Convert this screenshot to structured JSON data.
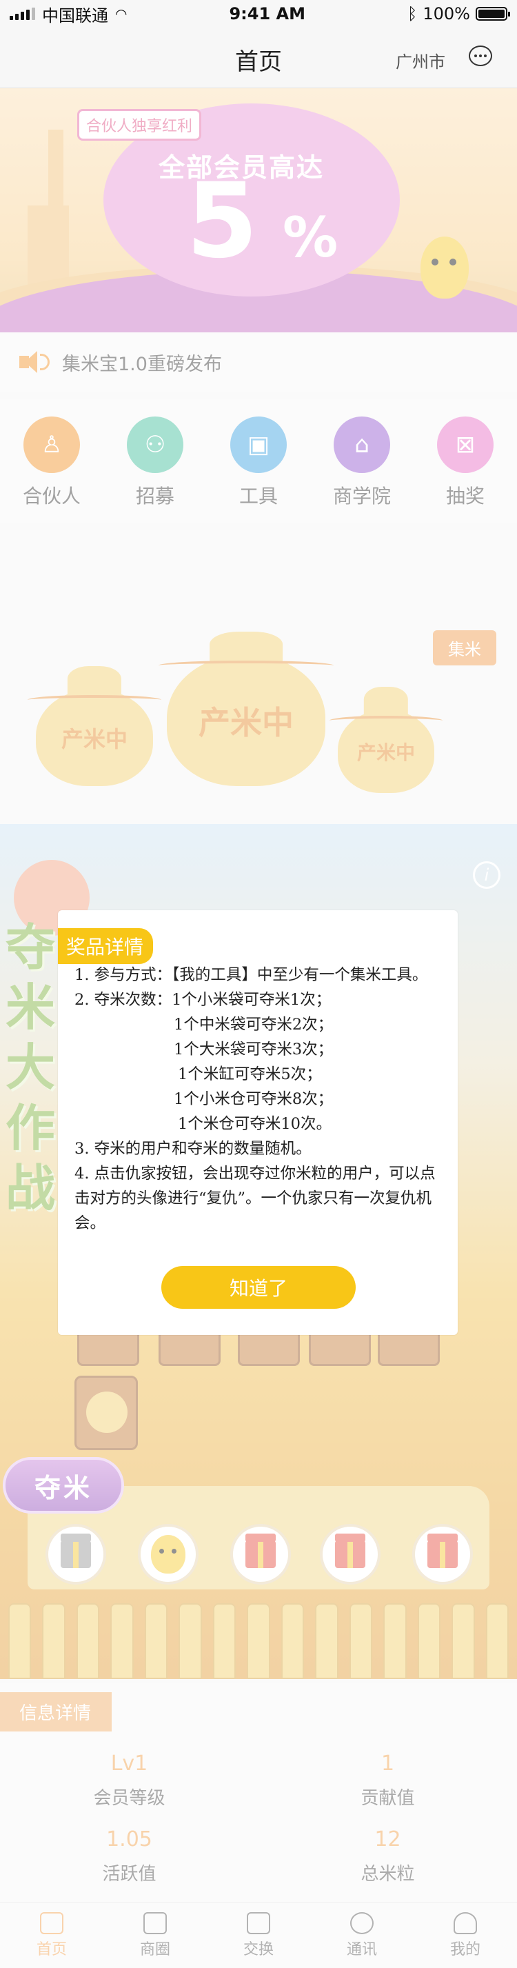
{
  "status_bar": {
    "carrier": "中国联通",
    "time": "9:41 AM",
    "battery": "100%"
  },
  "nav": {
    "title": "首页",
    "city": "广州市",
    "chat_icon": "chat-bubble-icon"
  },
  "banner": {
    "tag": "合伙人独享红利",
    "headline": "全部会员高达",
    "number": "5",
    "percent": "%"
  },
  "notice": {
    "text": "集米宝1.0重磅发布",
    "icon": "speaker-icon"
  },
  "menu": [
    {
      "label": "合伙人",
      "icon": "partner-icon",
      "color": "#f29b38"
    },
    {
      "label": "招募",
      "icon": "recruit-icon",
      "color": "#4fc3a3"
    },
    {
      "label": "工具",
      "icon": "tool-icon",
      "color": "#4aa8e2"
    },
    {
      "label": "商学院",
      "icon": "academy-icon",
      "color": "#9a65d3"
    },
    {
      "label": "抽奖",
      "icon": "lottery-icon",
      "color": "#e878c9"
    }
  ],
  "produce": {
    "gather_label": "集米",
    "bags": [
      "产米中",
      "产米中",
      "产米中"
    ]
  },
  "game": {
    "title_chars": [
      "夺",
      "米",
      "大",
      "作",
      "战"
    ],
    "info_icon": "i",
    "grab_label": "夺米"
  },
  "modal": {
    "title": "奖品详情",
    "lines": {
      "l1": "1. 参与方式：【我的工具】中至少有一个集米工具。",
      "l2": "2. 夺米次数：1个小米袋可夺米1次；",
      "l3": "1个中米袋可夺米2次；",
      "l4": "1个大米袋可夺米3次；",
      "l5": "1个米缸可夺米5次；",
      "l6": "1个小米仓可夺米8次；",
      "l7": "1个米仓可夺米10次。",
      "l8": "3. 夺米的用户和夺米的数量随机。",
      "l9": "4. 点击仇家按钮，会出现夺过你米粒的用户，可以点击对方的头像进行“复仇”。一个仇家只有一次复仇机会。"
    },
    "ok_label": "知道了"
  },
  "info": {
    "tab": "信息详情",
    "cells": [
      {
        "value": "Lv1",
        "label": "会员等级"
      },
      {
        "value": "1",
        "label": "贡献值"
      },
      {
        "value": "1.05",
        "label": "活跃值"
      },
      {
        "value": "12",
        "label": "总米粒"
      }
    ]
  },
  "tabbar": [
    {
      "label": "首页",
      "icon": "home-icon"
    },
    {
      "label": "商圈",
      "icon": "shop-icon"
    },
    {
      "label": "交换",
      "icon": "exchange-icon"
    },
    {
      "label": "通讯",
      "icon": "message-icon"
    },
    {
      "label": "我的",
      "icon": "profile-icon"
    }
  ],
  "colors": {
    "accent": "#f8c617",
    "orange": "#f0a656"
  }
}
